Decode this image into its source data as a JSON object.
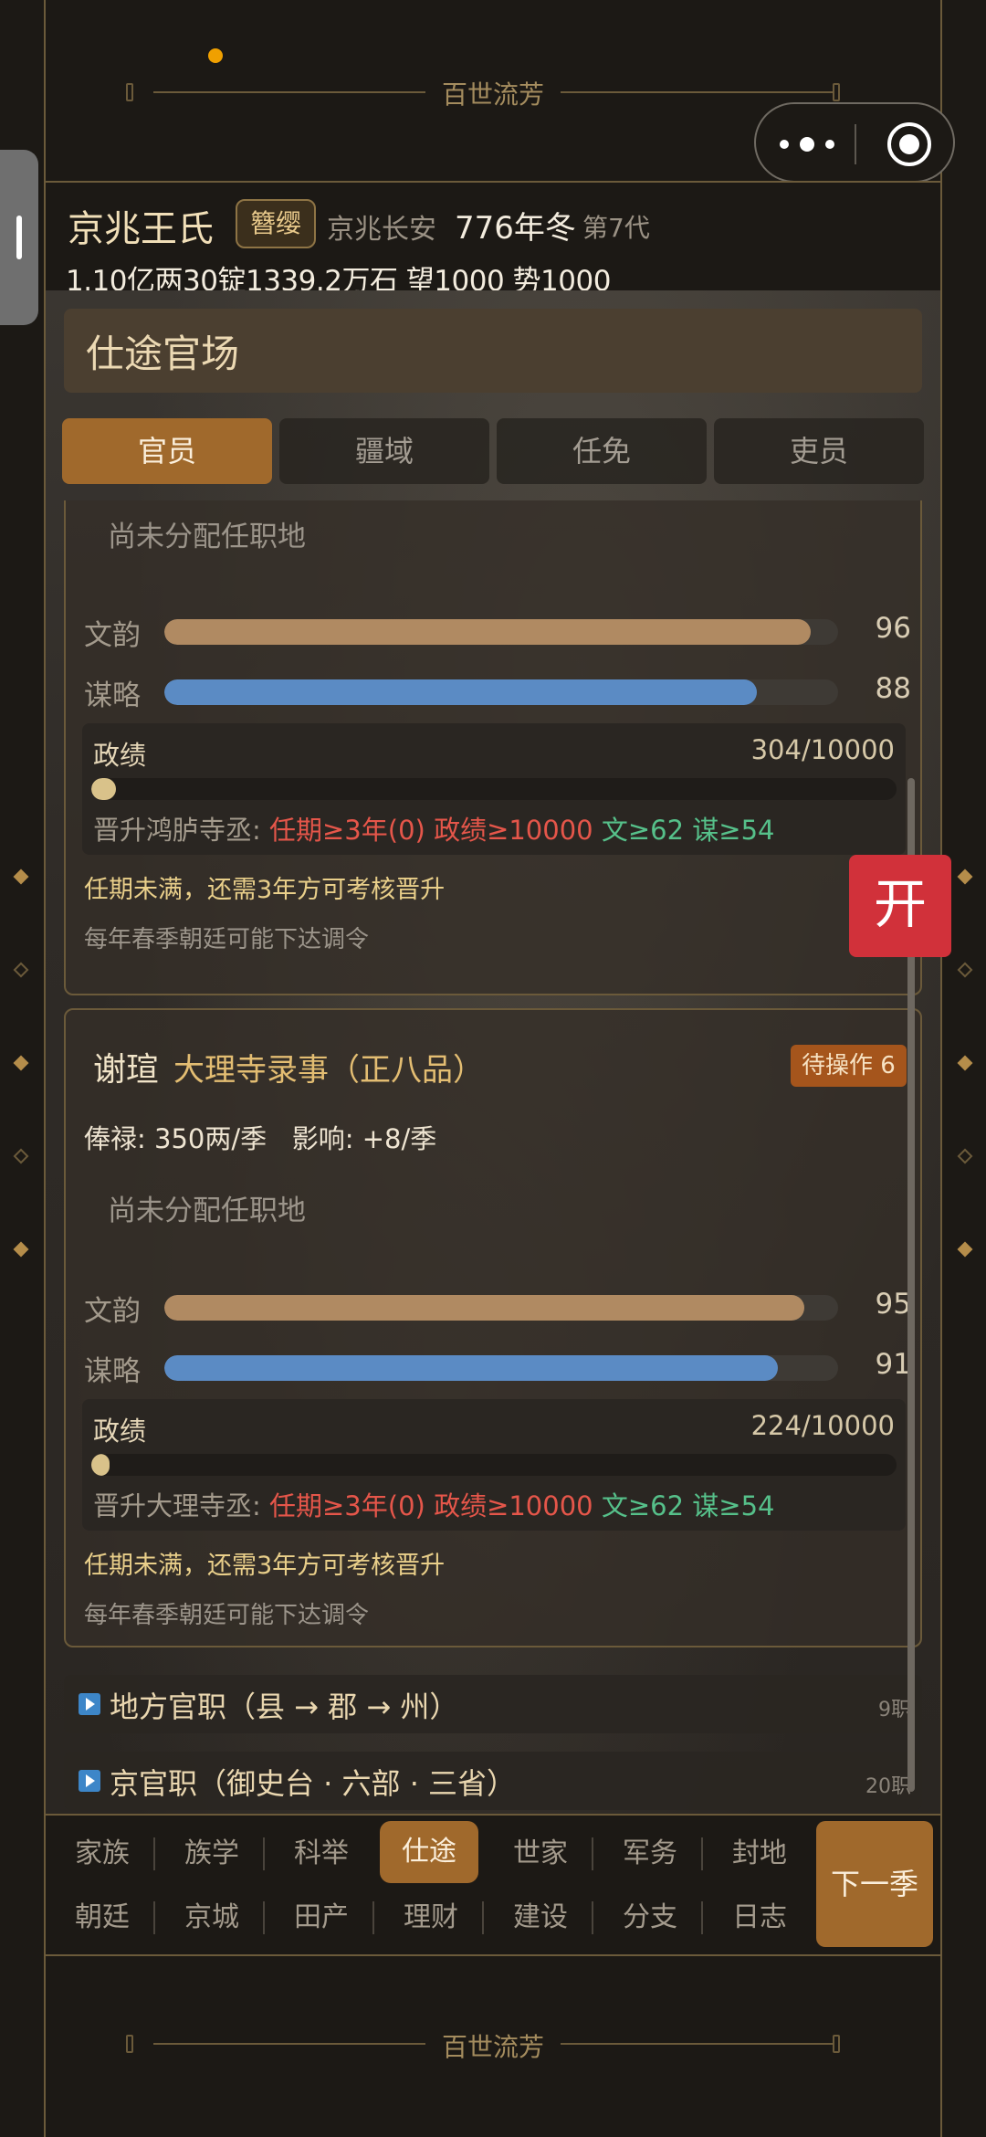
{
  "app": {
    "title": "百世流芳"
  },
  "header": {
    "clan_name": "京兆王氏",
    "rank_badge": "簪缨",
    "location": "京兆长安",
    "year_season": "776年冬",
    "generation": "第7代",
    "assets": "1.10亿两30锭1339.2万石 望1000 势1000"
  },
  "panel": {
    "title": "仕途官场",
    "tabs": [
      {
        "label": "官员",
        "active": true
      },
      {
        "label": "疆域",
        "active": false
      },
      {
        "label": "任免",
        "active": false
      },
      {
        "label": "吏员",
        "active": false
      }
    ]
  },
  "officials": [
    {
      "unassigned": "尚未分配任职地",
      "stats": [
        {
          "label": "文韵",
          "value": 96,
          "max": 100,
          "color": "#b08a62"
        },
        {
          "label": "谋略",
          "value": 88,
          "max": 100,
          "color": "#5b8bc4"
        }
      ],
      "performance": {
        "label": "政绩",
        "value": "304/10000",
        "current": 304,
        "max": 10000
      },
      "promotion": {
        "prefix": "晋升鸿胪寺丞:",
        "req_term": "任期≥3年(0)",
        "req_perf": "政绩≥10000",
        "req_wen": "文≥62",
        "req_mou": "谋≥54"
      },
      "term_note": "任期未满，还需3年方可考核晋升",
      "edict_note": "每年春季朝廷可能下达调令"
    },
    {
      "name": "谢瑄",
      "post": "大理寺录事（正八品）",
      "pending": "待操作 6",
      "salary": "俸禄: 350两/季   影响: +8/季",
      "unassigned": "尚未分配任职地",
      "stats": [
        {
          "label": "文韵",
          "value": 95,
          "max": 100,
          "color": "#b08a62"
        },
        {
          "label": "谋略",
          "value": 91,
          "max": 100,
          "color": "#5b8bc4"
        }
      ],
      "performance": {
        "label": "政绩",
        "value": "224/10000",
        "current": 224,
        "max": 10000
      },
      "promotion": {
        "prefix": "晋升大理寺丞:",
        "req_term": "任期≥3年(0)",
        "req_perf": "政绩≥10000",
        "req_wen": "文≥62",
        "req_mou": "谋≥54"
      },
      "term_note": "任期未满，还需3年方可考核晋升",
      "edict_note": "每年春季朝廷可能下达调令"
    }
  ],
  "sections": [
    {
      "label": "地方官职（县 → 郡 → 州）",
      "count": "9职"
    },
    {
      "label": "京官职（御史台 · 六部 · 三省）",
      "count": "20职"
    }
  ],
  "float_button": "开",
  "nav": {
    "row1": [
      {
        "label": "家族",
        "active": false
      },
      {
        "label": "族学",
        "active": false
      },
      {
        "label": "科举",
        "active": false
      },
      {
        "label": "仕途",
        "active": true
      },
      {
        "label": "世家",
        "active": false
      },
      {
        "label": "军务",
        "active": false
      },
      {
        "label": "封地",
        "active": false
      }
    ],
    "row2": [
      {
        "label": "朝廷",
        "active": false
      },
      {
        "label": "京城",
        "active": false
      },
      {
        "label": "田产",
        "active": false
      },
      {
        "label": "理财",
        "active": false
      },
      {
        "label": "建设",
        "active": false
      },
      {
        "label": "分支",
        "active": false
      },
      {
        "label": "日志",
        "active": false
      }
    ],
    "next_season": "下一季"
  },
  "colors": {
    "accent": "#a0692c",
    "danger": "#e5564a",
    "success": "#56c08a",
    "wen_bar": "#b08a62",
    "mou_bar": "#5b8bc4"
  }
}
